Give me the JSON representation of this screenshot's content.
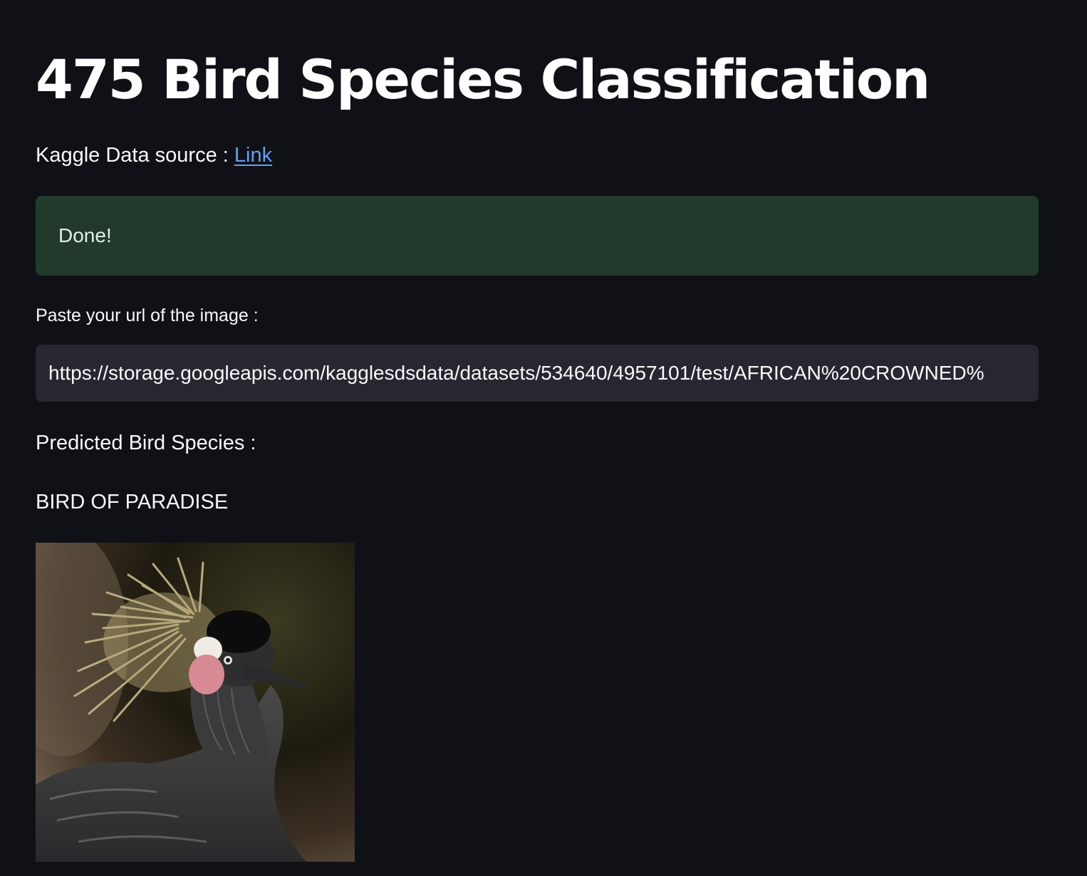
{
  "header": {
    "title": "475 Bird Species Classification"
  },
  "source": {
    "prefix": "Kaggle Data source : ",
    "link_label": "Link"
  },
  "status": {
    "message": "Done!",
    "color": "#213a2c"
  },
  "url_field": {
    "label": "Paste your url of the image :",
    "value": "https://storage.googleapis.com/kagglesdsdata/datasets/534640/4957101/test/AFRICAN%20CROWNED%"
  },
  "prediction": {
    "label": "Predicted Bird Species :",
    "value": "BIRD OF PARADISE"
  },
  "image": {
    "icon": "bird-photo",
    "subject": "crowned crane"
  },
  "theme": {
    "background": "#0f1117",
    "link_color": "#5ea1f7",
    "input_background": "#262730"
  }
}
